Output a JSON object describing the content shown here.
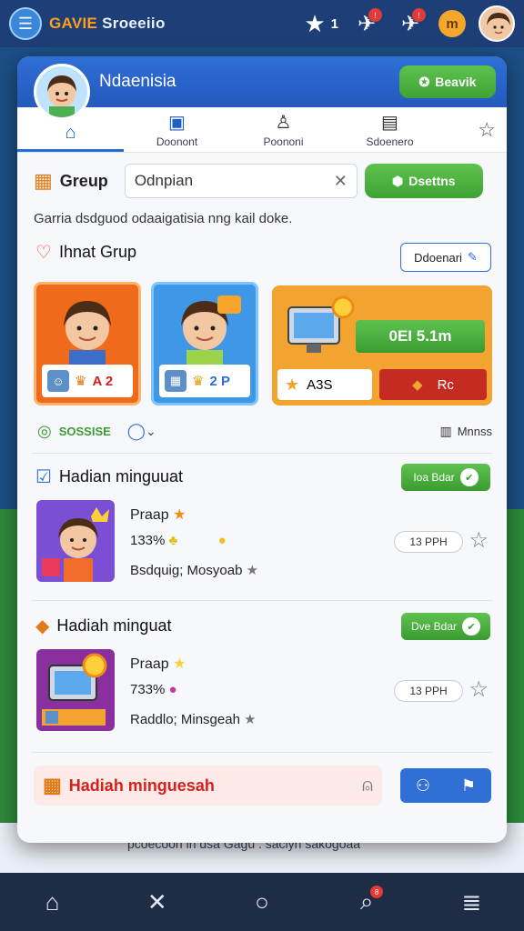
{
  "topbar": {
    "title_part1": "GAVIE",
    "title_part2": " Sroeeiio",
    "star_count": "1",
    "icon_menu": "menu-icon",
    "icon_star": "star-icon",
    "icon_pin1": "pin-icon",
    "icon_pin2": "pin-icon",
    "coin": "m",
    "icon_avatar": "avatar-icon"
  },
  "panel": {
    "header": {
      "name": "Ndaenisia",
      "action_label": "Beavik",
      "action_icon": "star-icon"
    },
    "tabs": [
      {
        "label": "",
        "icon": "home-icon"
      },
      {
        "label": "Doonont",
        "icon": "book-icon"
      },
      {
        "label": "Poononi",
        "icon": "user-icon"
      },
      {
        "label": "Sdoenero",
        "icon": "lock-icon"
      }
    ],
    "tab_favorite_icon": "star-outline-icon",
    "group": {
      "label": "Greup",
      "search_value": "Odnpian",
      "button_label": "Dsettns"
    },
    "description": "Garria dsdguod odaaigatisia nng kail doke.",
    "inat_group": {
      "title": "Ihnat Grup",
      "button_label": "Ddoenari",
      "cards": [
        {
          "foot_text": "A 2",
          "bg": "#f06a1c"
        },
        {
          "foot_text": "2 P",
          "bg": "#3f97e8"
        },
        {
          "foot_text": "A3S",
          "bg": "#f3a430",
          "green_label": "0EI 5.1m",
          "red_label": "Rc"
        }
      ],
      "sub_left": "SOSSISE",
      "sub_right": "Mnnss"
    },
    "rewards_title_1": "Hadian minguuat",
    "rewards_title_2": "Hadiah minguat",
    "rewards": [
      {
        "claim_label": "Ioa Bdar",
        "name": "Praap",
        "pct": "133%",
        "meta": "Bsdquig; Mosyoab",
        "time": "13 PPH"
      },
      {
        "claim_label": "Dve Bdar",
        "name": "Praap",
        "pct": "733%",
        "meta": "Raddlo; Minsgeah",
        "time": "13 PPH"
      }
    ],
    "footer": {
      "label": "Hadiah minguesah"
    }
  },
  "background_strip": "pcoecoon lh dsa Gagu . saclyh sakogoaa",
  "bottom_nav": {
    "items": [
      "home-icon",
      "close-icon",
      "circle-icon",
      "search-icon",
      "menu-icon"
    ],
    "badge": "8"
  },
  "colors": {
    "primary": "#2f6fd6",
    "green": "#4cae3e",
    "orange": "#f06a1c",
    "red": "#d6201c"
  }
}
